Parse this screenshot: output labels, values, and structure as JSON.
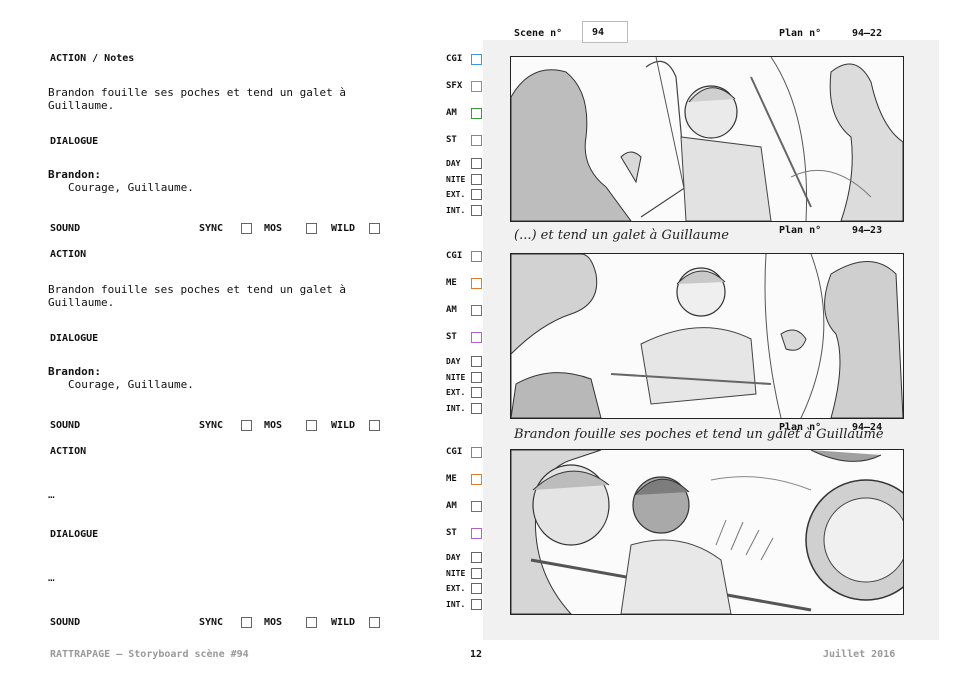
{
  "left": {
    "blocks": [
      {
        "heading": "ACTION / Notes",
        "action_text": "Brandon fouille ses poches et tend un galet à\nGuillaume.",
        "dialogue_heading": "DIALOGUE",
        "speaker": "Brandon:",
        "line": "Courage, Guillaume.",
        "sound": "SOUND",
        "sync": "SYNC",
        "mos": "MOS",
        "wild": "WILD"
      },
      {
        "heading": "ACTION",
        "action_text": "Brandon fouille ses poches et tend un galet à\nGuillaume.",
        "dialogue_heading": "DIALOGUE",
        "speaker": "Brandon:",
        "line": "Courage, Guillaume.",
        "sound": "SOUND",
        "sync": "SYNC",
        "mos": "MOS",
        "wild": "WILD"
      },
      {
        "heading": "ACTION",
        "action_text": "…",
        "dialogue_heading": "DIALOGUE",
        "dialogue_text": "…",
        "sound": "SOUND",
        "sync": "SYNC",
        "mos": "MOS",
        "wild": "WILD"
      }
    ]
  },
  "header": {
    "scene_label": "Scene n°",
    "scene_value": "94",
    "plan_label": "Plan n°"
  },
  "panels": [
    {
      "plan_value": "94–22",
      "checks": [
        "CGI",
        "SFX",
        "AM",
        "ST"
      ],
      "times": [
        "DAY",
        "NITE",
        "EXT.",
        "INT."
      ],
      "caption": "(...)     et   tend   un   galet   à   Guillaume"
    },
    {
      "plan_label": "Plan n°",
      "plan_value": "94–23",
      "checks": [
        "CGI",
        "ME",
        "AM",
        "ST"
      ],
      "times": [
        "DAY",
        "NITE",
        "EXT.",
        "INT."
      ],
      "caption": "Brandon  fouille  ses  poches  et  tend  un  galet  à  Guillaume"
    },
    {
      "plan_label": "Plan n°",
      "plan_value": "94–24",
      "checks": [
        "CGI",
        "ME",
        "AM",
        "ST"
      ],
      "times": [
        "DAY",
        "NITE",
        "EXT.",
        "INT."
      ]
    }
  ],
  "check_colors": {
    "CGI": "#3a9ad9",
    "SFX": "#e07b2e",
    "ME": "#e07b2e",
    "AM": "#3a9a3a",
    "ST": "#b064c9"
  },
  "footer": {
    "left": "RATTRAPAGE — Storyboard scène #94",
    "page": "12",
    "right": "Juillet 2016"
  }
}
